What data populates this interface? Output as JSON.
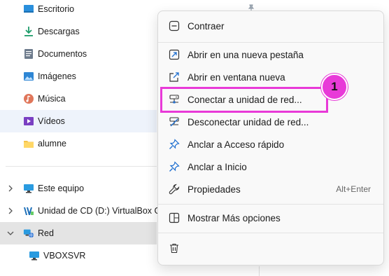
{
  "nav": {
    "items": [
      {
        "label": "Escritorio",
        "icon": "desktop-icon"
      },
      {
        "label": "Descargas",
        "icon": "download-icon"
      },
      {
        "label": "Documentos",
        "icon": "document-icon"
      },
      {
        "label": "Imágenes",
        "icon": "image-icon"
      },
      {
        "label": "Música",
        "icon": "music-icon"
      },
      {
        "label": "Vídeos",
        "icon": "video-icon"
      },
      {
        "label": "alumne",
        "icon": "folder-icon"
      }
    ],
    "tree": [
      {
        "label": "Este equipo",
        "icon": "computer-icon",
        "expanded": false
      },
      {
        "label": "Unidad de CD (D:) VirtualBox Gu",
        "icon": "cd-drive-icon",
        "expanded": false
      },
      {
        "label": "Red",
        "icon": "network-icon",
        "expanded": true
      },
      {
        "label": "VBOXSVR",
        "icon": "computer-icon"
      }
    ]
  },
  "context_menu": {
    "items": [
      {
        "label": "Contraer",
        "icon": "collapse-icon"
      },
      {
        "label": "Abrir en una nueva pestaña",
        "icon": "new-tab-icon"
      },
      {
        "label": "Abrir en ventana nueva",
        "icon": "new-window-icon"
      },
      {
        "label": "Conectar a unidad de red...",
        "icon": "map-network-drive-icon"
      },
      {
        "label": "Desconectar unidad de red...",
        "icon": "disconnect-network-drive-icon"
      },
      {
        "label": "Anclar a Acceso rápido",
        "icon": "pin-icon"
      },
      {
        "label": "Anclar a Inicio",
        "icon": "pin-start-icon"
      },
      {
        "label": "Propiedades",
        "icon": "wrench-icon",
        "shortcut": "Alt+Enter"
      },
      {
        "label": "Mostrar Más opciones",
        "icon": "more-options-icon"
      },
      {
        "label": "",
        "icon": "trash-icon"
      }
    ]
  },
  "annotation": {
    "number": "1",
    "color": "#e83ad8"
  }
}
